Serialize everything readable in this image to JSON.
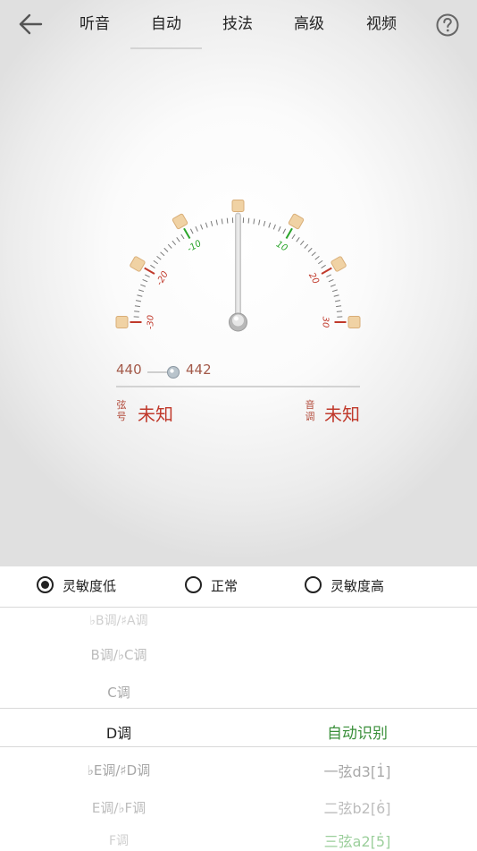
{
  "header": {
    "tabs": [
      {
        "label": "听音"
      },
      {
        "label": "自动"
      },
      {
        "label": "技法"
      },
      {
        "label": "高级"
      },
      {
        "label": "视频"
      }
    ],
    "active_tab": "自动"
  },
  "gauge": {
    "left_ticks": [
      "-10",
      "-20",
      "-30"
    ],
    "right_ticks": [
      "10",
      "20",
      "30"
    ],
    "needle_value": 0,
    "green_color": "#2aa52a",
    "red_color": "#c0392b"
  },
  "a4": {
    "min_label": "440",
    "max_label": "442"
  },
  "info": {
    "string_label_1": "弦",
    "string_label_2": "号",
    "string_value": "未知",
    "tone_label_1": "音",
    "tone_label_2": "调",
    "tone_value": "未知"
  },
  "sensitivity": {
    "options": [
      {
        "label": "灵敏度低",
        "checked": true
      },
      {
        "label": "正常",
        "checked": false
      },
      {
        "label": "灵敏度高",
        "checked": false
      }
    ]
  },
  "key_picker": {
    "items": [
      "♭B调/♯A调",
      "B调/♭C调",
      "C调",
      "D调",
      "♭E调/♯D调",
      "E调/♭F调",
      "F调"
    ],
    "selected": "D调"
  },
  "mode_picker": {
    "selected": "自动识别",
    "items": [
      "一弦d3[1̇]",
      "二弦b2[6̇]",
      "三弦a2[5̇]"
    ]
  }
}
